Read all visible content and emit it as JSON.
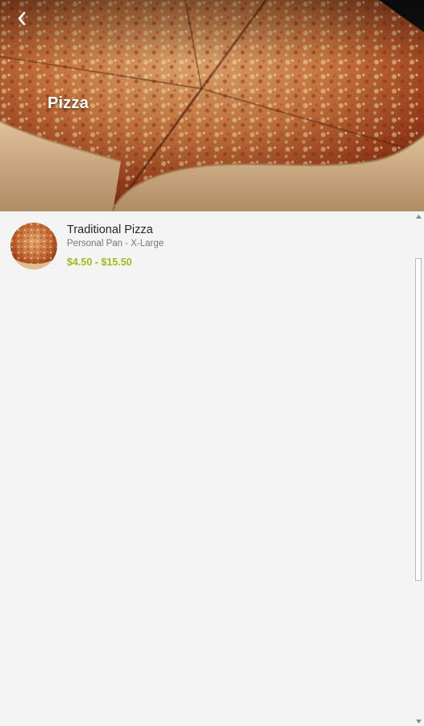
{
  "header": {
    "title": "Pizza",
    "back_icon": "chevron-left-icon",
    "image": "pizza-photo"
  },
  "items": [
    {
      "name": "Traditional Pizza",
      "subtitle": "Personal Pan - X-Large",
      "price": "$4.50 - $15.50",
      "thumb": "pizza-thumbnail"
    }
  ],
  "colors": {
    "price": "#9bbd1c",
    "title": "#ffffff",
    "background": "#f4f4f4"
  }
}
